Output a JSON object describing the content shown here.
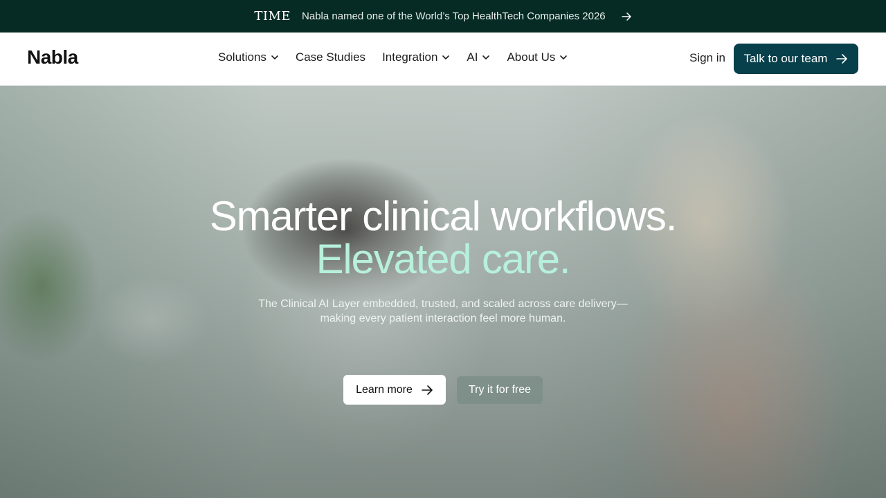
{
  "announcement": {
    "brand": "TIME",
    "text": "Nabla named one of the World’s Top HealthTech Companies 2026",
    "icon": "arrow-right-icon"
  },
  "header": {
    "logo": "Nabla",
    "nav": [
      {
        "label": "Solutions",
        "has_dropdown": true
      },
      {
        "label": "Case Studies",
        "has_dropdown": false
      },
      {
        "label": "Integration",
        "has_dropdown": true
      },
      {
        "label": "AI",
        "has_dropdown": true
      },
      {
        "label": "About Us",
        "has_dropdown": true
      }
    ],
    "sign_in": "Sign in",
    "cta": "Talk to our team"
  },
  "hero": {
    "title_line1": "Smarter clinical workflows.",
    "title_line2": "Elevated care.",
    "subtitle_line1": "The Clinical AI Layer embedded, trusted, and scaled across care delivery—",
    "subtitle_line2": "making every patient interaction feel more human.",
    "primary_button": "Learn more",
    "secondary_button": "Try it for free"
  },
  "colors": {
    "announce_bg": "#062a24",
    "cta_bg": "#073f4a",
    "accent_text": "#b7f0dc"
  }
}
